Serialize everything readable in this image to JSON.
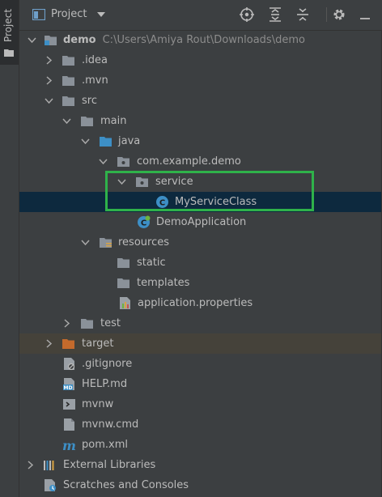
{
  "side_strip": {
    "tab_label": "Project"
  },
  "toolbar": {
    "view_label": "Project",
    "buttons": [
      "locate-icon",
      "expand-all-icon",
      "collapse-all-icon",
      "gear-icon",
      "hide-icon"
    ]
  },
  "tree": {
    "root": {
      "name": "demo",
      "path": "C:\\Users\\Amiya Rout\\Downloads\\demo"
    },
    "idea": ".idea",
    "mvn": ".mvn",
    "src": "src",
    "main": "main",
    "java": "java",
    "package": "com.example.demo",
    "service": "service",
    "service_class": "MyServiceClass",
    "demo_app": "DemoApplication",
    "resources": "resources",
    "static": "static",
    "templates": "templates",
    "app_props": "application.properties",
    "test": "test",
    "target": "target",
    "gitignore": ".gitignore",
    "help": "HELP.md",
    "mvnw": "mvnw",
    "mvnw_cmd": "mvnw.cmd",
    "pom": "pom.xml",
    "external_libs": "External Libraries",
    "scratches": "Scratches and Consoles"
  },
  "colors": {
    "background": "#3c3f41",
    "selection": "#0d293e",
    "highlight": "#2fb24a",
    "folder": "#8a9199",
    "source_folder": "#3d8fc6",
    "excluded_folder": "#c46a2c"
  }
}
